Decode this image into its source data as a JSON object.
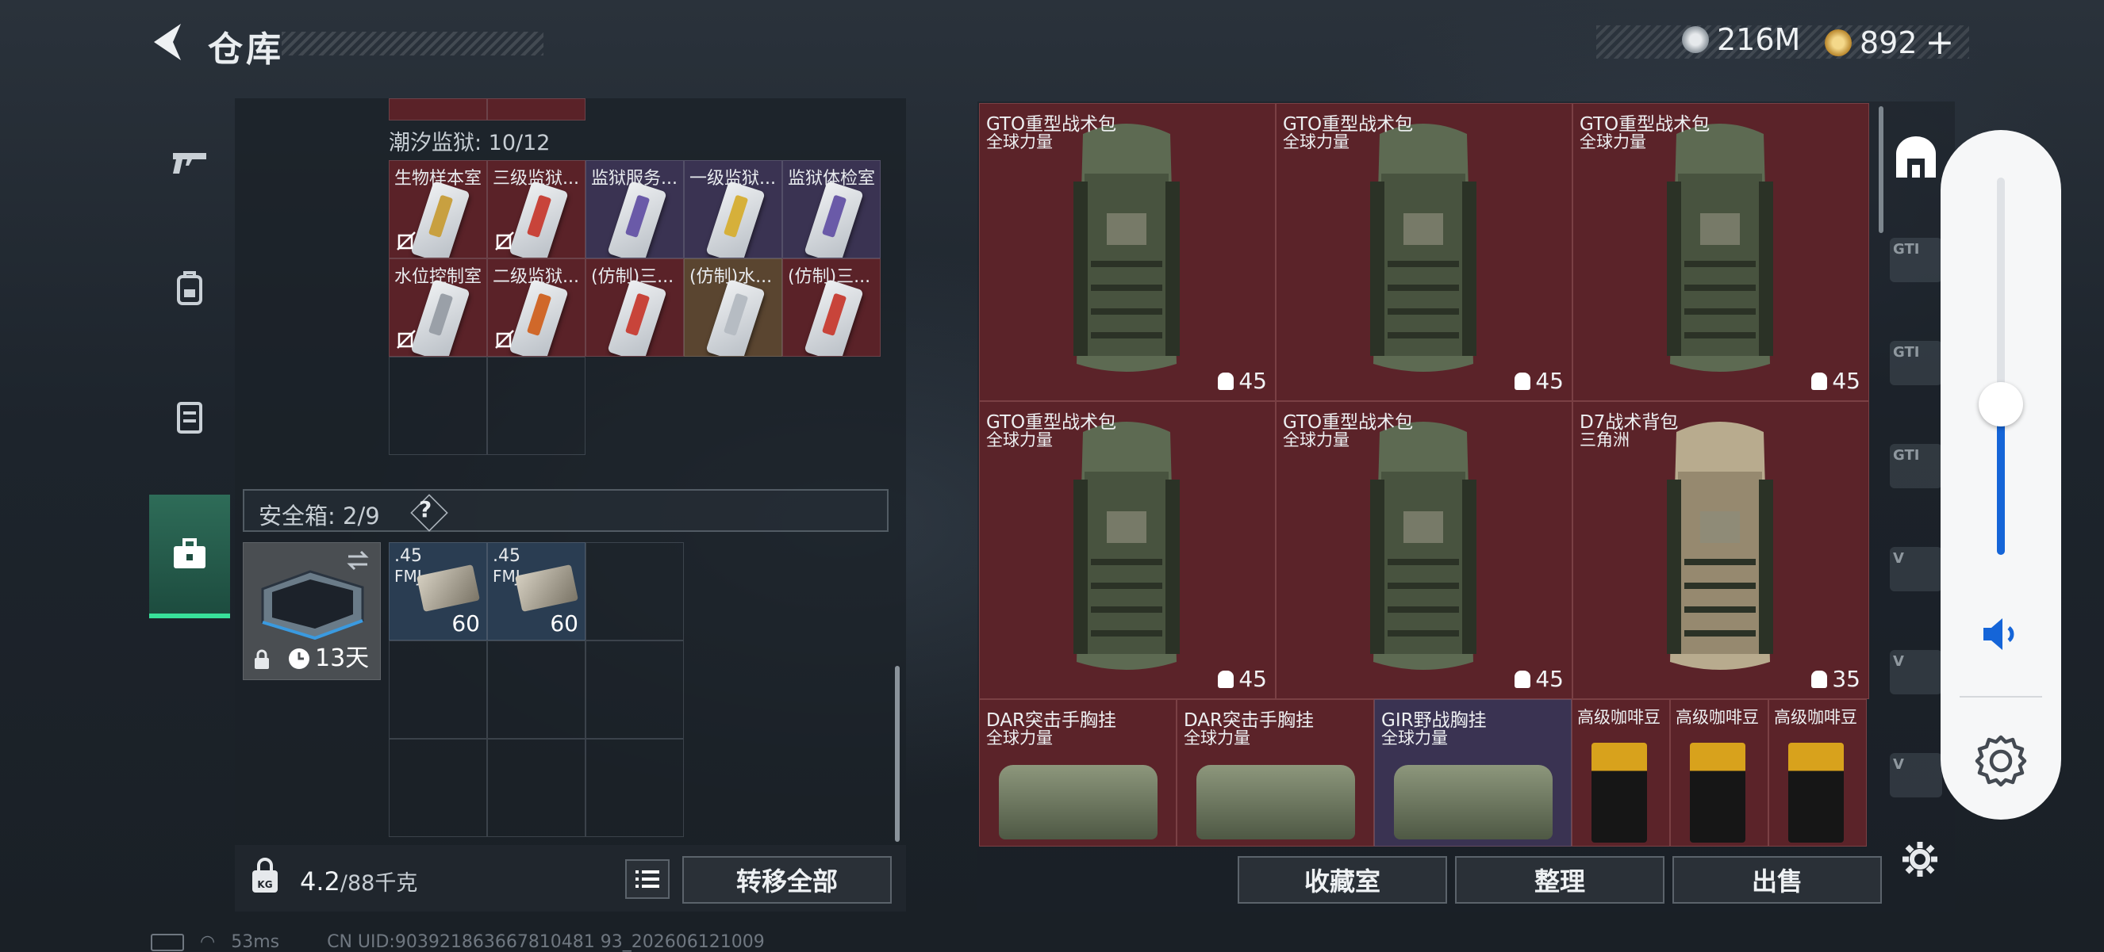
{
  "header": {
    "title": "仓库",
    "currency_silver": "216M",
    "currency_gold": "892",
    "currency_plus": "+"
  },
  "left": {
    "tidal_section": "潮汐监狱: 10/12",
    "items": [
      {
        "name": "生物样本室",
        "color": "red",
        "strip": "#c8a040",
        "locked": true
      },
      {
        "name": "三级监狱...",
        "color": "red",
        "strip": "#c8443a",
        "locked": true
      },
      {
        "name": "监狱服务...",
        "color": "purple",
        "strip": "#6a5aa8",
        "locked": false
      },
      {
        "name": "一级监狱...",
        "color": "purple",
        "strip": "#d6b03a",
        "locked": false
      },
      {
        "name": "监狱体检室",
        "color": "purple",
        "strip": "#6a5aa8",
        "locked": false
      },
      {
        "name": "水位控制室",
        "color": "red",
        "strip": "#9aa0a8",
        "locked": true
      },
      {
        "name": "二级监狱...",
        "color": "red",
        "strip": "#d0682a",
        "locked": true
      },
      {
        "name": "(仿制)三...",
        "color": "red",
        "strip": "#c8443a",
        "locked": false
      },
      {
        "name": "(仿制)水...",
        "color": "brown",
        "strip": "#b6bcc3",
        "locked": false
      },
      {
        "name": "(仿制)三...",
        "color": "red",
        "strip": "#c8443a",
        "locked": false
      }
    ],
    "safe_box": {
      "label": "安全箱: 2/9",
      "help": "?",
      "timer": "13天"
    },
    "ammo": [
      {
        "name": ".45",
        "sub": "FMJ",
        "count": "60"
      },
      {
        "name": ".45",
        "sub": "FMJ",
        "count": "60"
      }
    ],
    "weight": "4.2",
    "weight_max": "/88千克",
    "transfer_all": "转移全部"
  },
  "right": {
    "backpacks": [
      {
        "name": "GTO重型战术包",
        "sub": "全球力量",
        "cap": "45",
        "tone": "green"
      },
      {
        "name": "GTO重型战术包",
        "sub": "全球力量",
        "cap": "45",
        "tone": "green"
      },
      {
        "name": "GTO重型战术包",
        "sub": "全球力量",
        "cap": "45",
        "tone": "green"
      },
      {
        "name": "GTO重型战术包",
        "sub": "全球力量",
        "cap": "45",
        "tone": "green"
      },
      {
        "name": "GTO重型战术包",
        "sub": "全球力量",
        "cap": "45",
        "tone": "green"
      },
      {
        "name": "D7战术背包",
        "sub": "三角洲",
        "cap": "35",
        "tone": "tan"
      }
    ],
    "rigs": [
      {
        "name": "DAR突击手胸挂",
        "sub": "全球力量",
        "color": "red"
      },
      {
        "name": "DAR突击手胸挂",
        "sub": "全球力量",
        "color": "red"
      },
      {
        "name": "GIR野战胸挂",
        "sub": "全球力量",
        "color": "purple"
      }
    ],
    "coffee": [
      "高级咖啡豆",
      "高级咖啡豆",
      "高级咖啡豆"
    ],
    "side_icons": [
      "GTI",
      "GTI",
      "GTI",
      "V",
      "V",
      "V"
    ],
    "buttons": {
      "collection": "收藏室",
      "sort": "整理",
      "sell": "出售"
    }
  },
  "status": {
    "ping": "53ms",
    "uid": "CN UID:903921863667810481 93_202606121009"
  },
  "colors": {
    "accent_green": "#38e09a",
    "slot_red": "#5b2329",
    "volume_blue": "#1565d8"
  },
  "volume": {
    "level": 0.4
  }
}
